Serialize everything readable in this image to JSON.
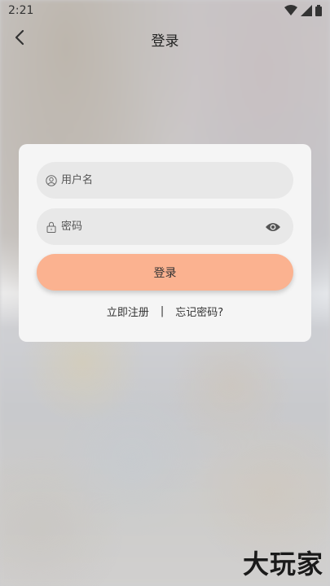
{
  "status_bar": {
    "time": "2:21",
    "icons": [
      "wifi-icon",
      "signal-icon",
      "battery-icon"
    ]
  },
  "nav": {
    "back_icon": "chevron-left-icon",
    "title": "登录"
  },
  "login_form": {
    "username": {
      "placeholder": "用户名",
      "value": "",
      "icon": "user-icon"
    },
    "password": {
      "placeholder": "密码",
      "value": "",
      "icon": "lock-icon",
      "toggle_icon": "eye-icon"
    },
    "submit_label": "登录",
    "register_link": "立即注册",
    "separator": "|",
    "forgot_link": "忘记密码?"
  },
  "watermark": "大玩家",
  "colors": {
    "button_accent": "#fbb290",
    "card_bg": "#f5f5f5",
    "field_bg": "#e8e8e8"
  }
}
